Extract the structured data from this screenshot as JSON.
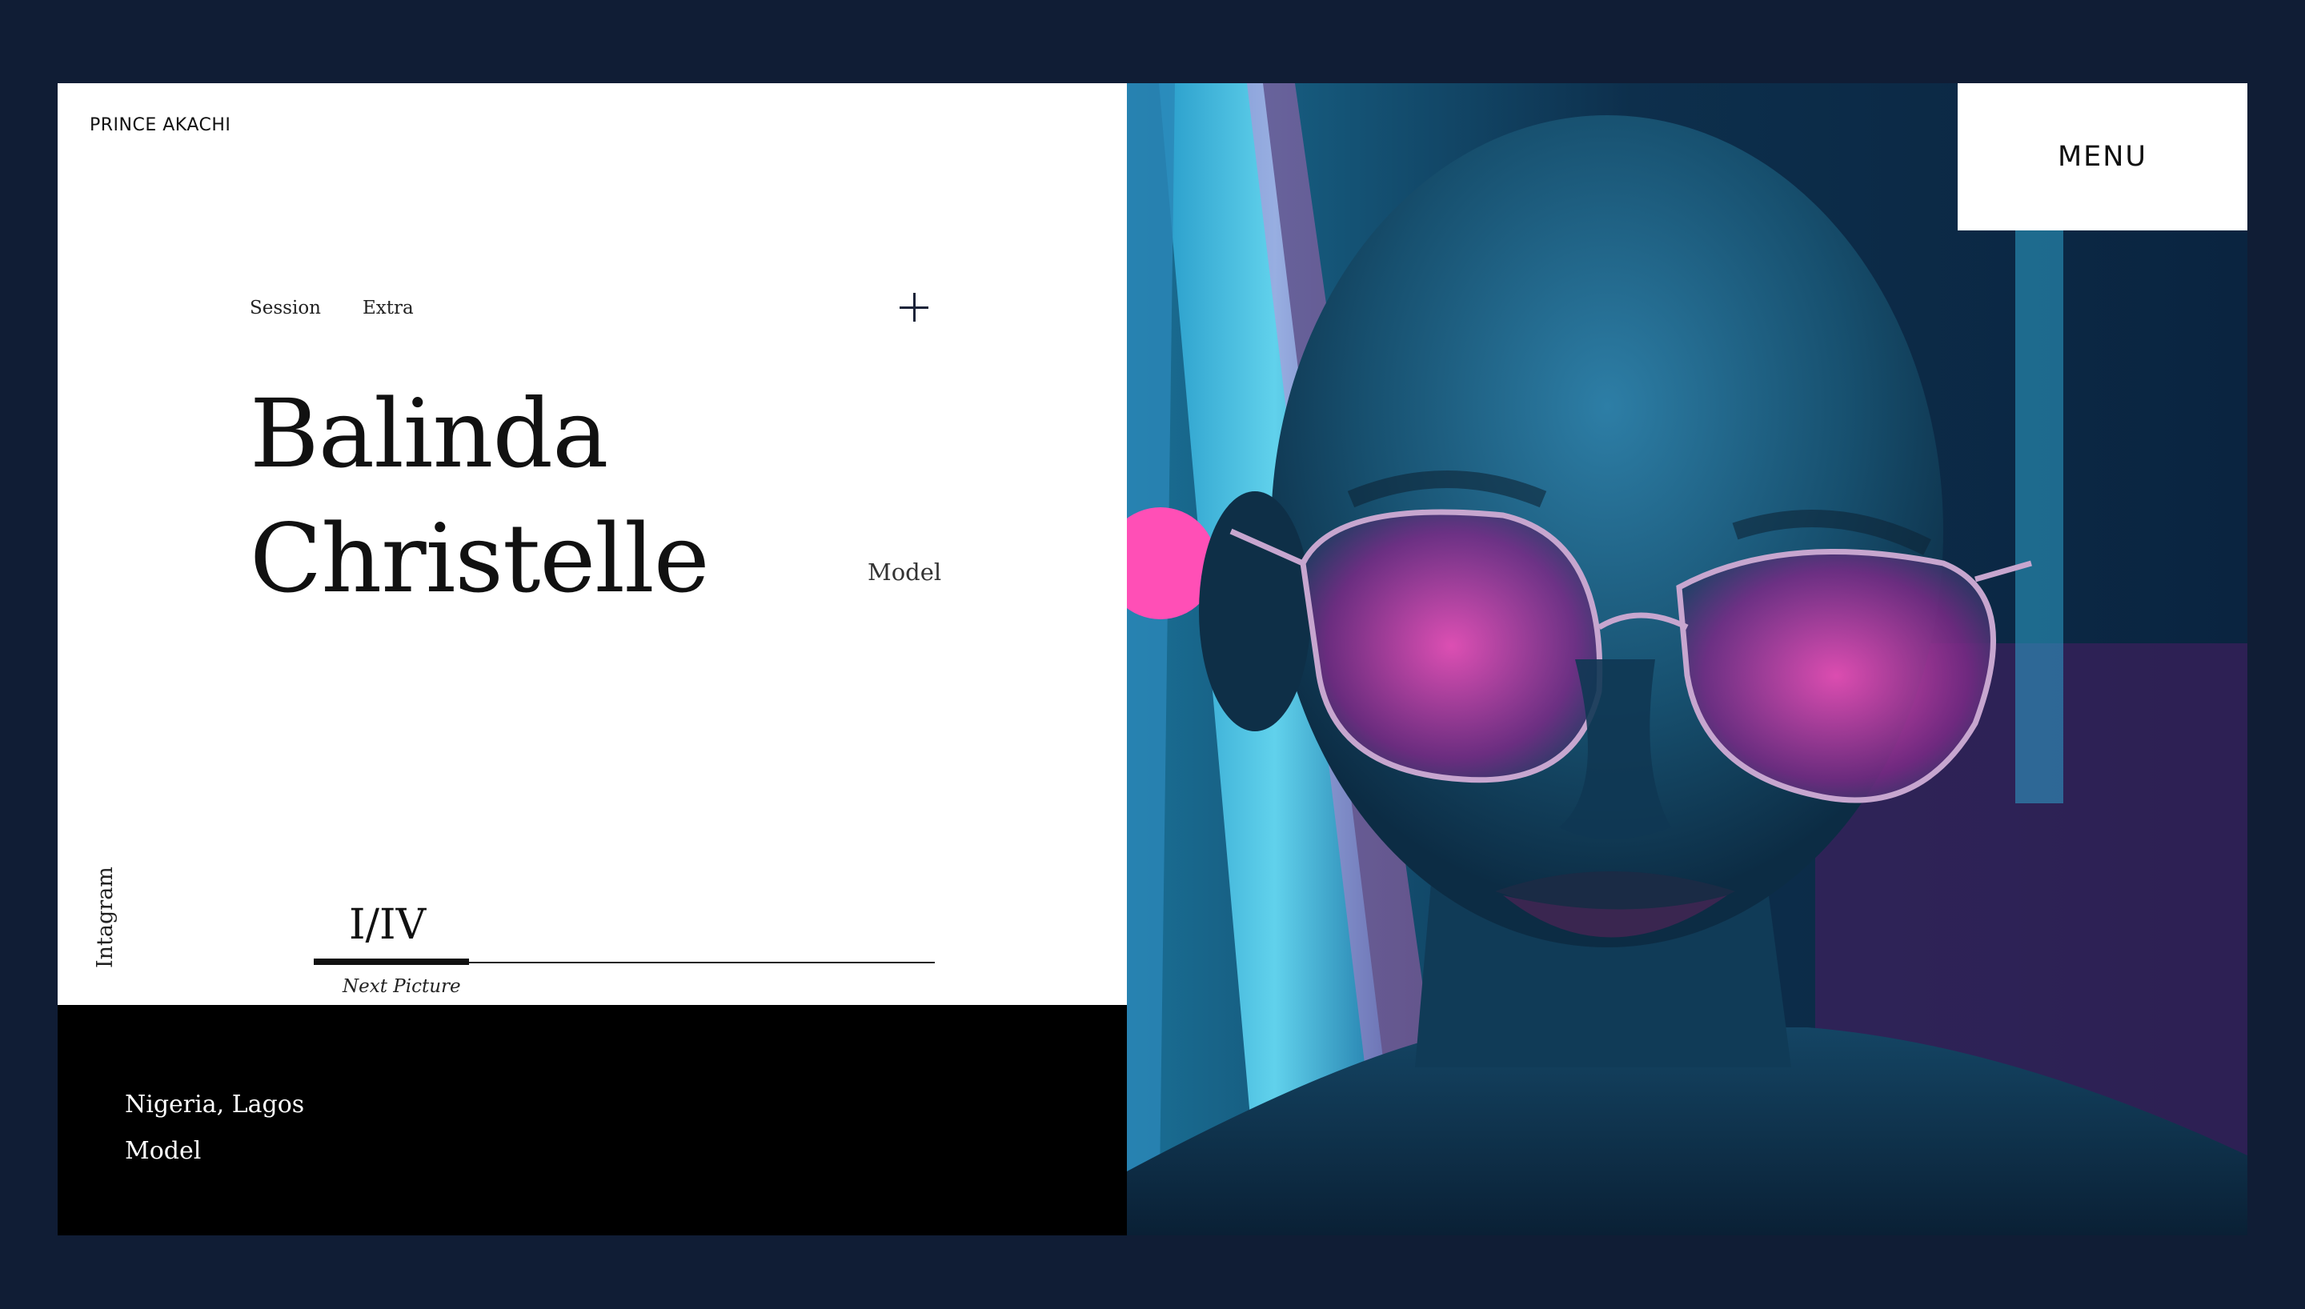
{
  "brand": "PRINCE AKACHI",
  "subnav": [
    "Session",
    "Extra"
  ],
  "title": [
    "Balinda",
    "Christelle"
  ],
  "role_side": "Model",
  "social_link": "Intagram",
  "slider": {
    "counter": "I/IV",
    "next_label": "Next Picture",
    "progress": 0.25
  },
  "footer": {
    "location": "Nigeria, Lagos",
    "role": "Model"
  },
  "menu_label": "MENU",
  "colors": {
    "background": "#101d35",
    "panel": "#ffffff",
    "footer": "#000000",
    "neon_cyan": "#39c6ea",
    "neon_pink": "#ff3fb4"
  },
  "icons": {
    "plus": "plus-icon"
  }
}
